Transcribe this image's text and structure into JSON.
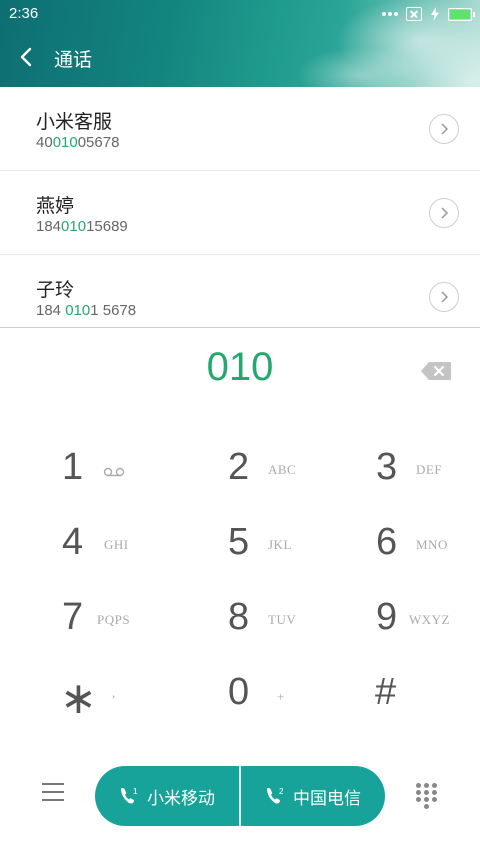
{
  "status_bar": {
    "time": "2:36",
    "icons": [
      "more-dots-icon",
      "no-sim-icon",
      "charging-bolt-icon",
      "battery-icon"
    ],
    "battery_color": "#5fe36a"
  },
  "header": {
    "title": "通话",
    "back_icon": "chevron-left-icon"
  },
  "contacts": [
    {
      "name": "小米客服",
      "number_pre": "40",
      "number_match": "010",
      "number_post": "05678"
    },
    {
      "name": "燕婷",
      "number_pre": "184",
      "number_match": "010",
      "number_post": "15689"
    },
    {
      "name": "子玲",
      "number_pre": "184 ",
      "number_match": "010",
      "number_post": "1 5678"
    }
  ],
  "dial": {
    "input": "010",
    "backspace_icon": "backspace-icon"
  },
  "keypad": [
    {
      "digit": "1",
      "letters": "",
      "icon": "voicemail-icon"
    },
    {
      "digit": "2",
      "letters": "ABC"
    },
    {
      "digit": "3",
      "letters": "DEF"
    },
    {
      "digit": "4",
      "letters": "GHI"
    },
    {
      "digit": "5",
      "letters": "JKL"
    },
    {
      "digit": "6",
      "letters": "MNO"
    },
    {
      "digit": "7",
      "letters": "PQPS"
    },
    {
      "digit": "8",
      "letters": "TUV"
    },
    {
      "digit": "9",
      "letters": "WXYZ"
    },
    {
      "digit": "∗",
      "letters": ","
    },
    {
      "digit": "0",
      "letters": "+"
    },
    {
      "digit": "#",
      "letters": ""
    }
  ],
  "actions": {
    "sim1_label": "小米移动",
    "sim2_label": "中国电信",
    "menu_icon": "menu-icon",
    "dialpad_icon": "dialpad-icon"
  },
  "colors": {
    "accent": "#25a870",
    "call_bar": "#17a39a"
  }
}
